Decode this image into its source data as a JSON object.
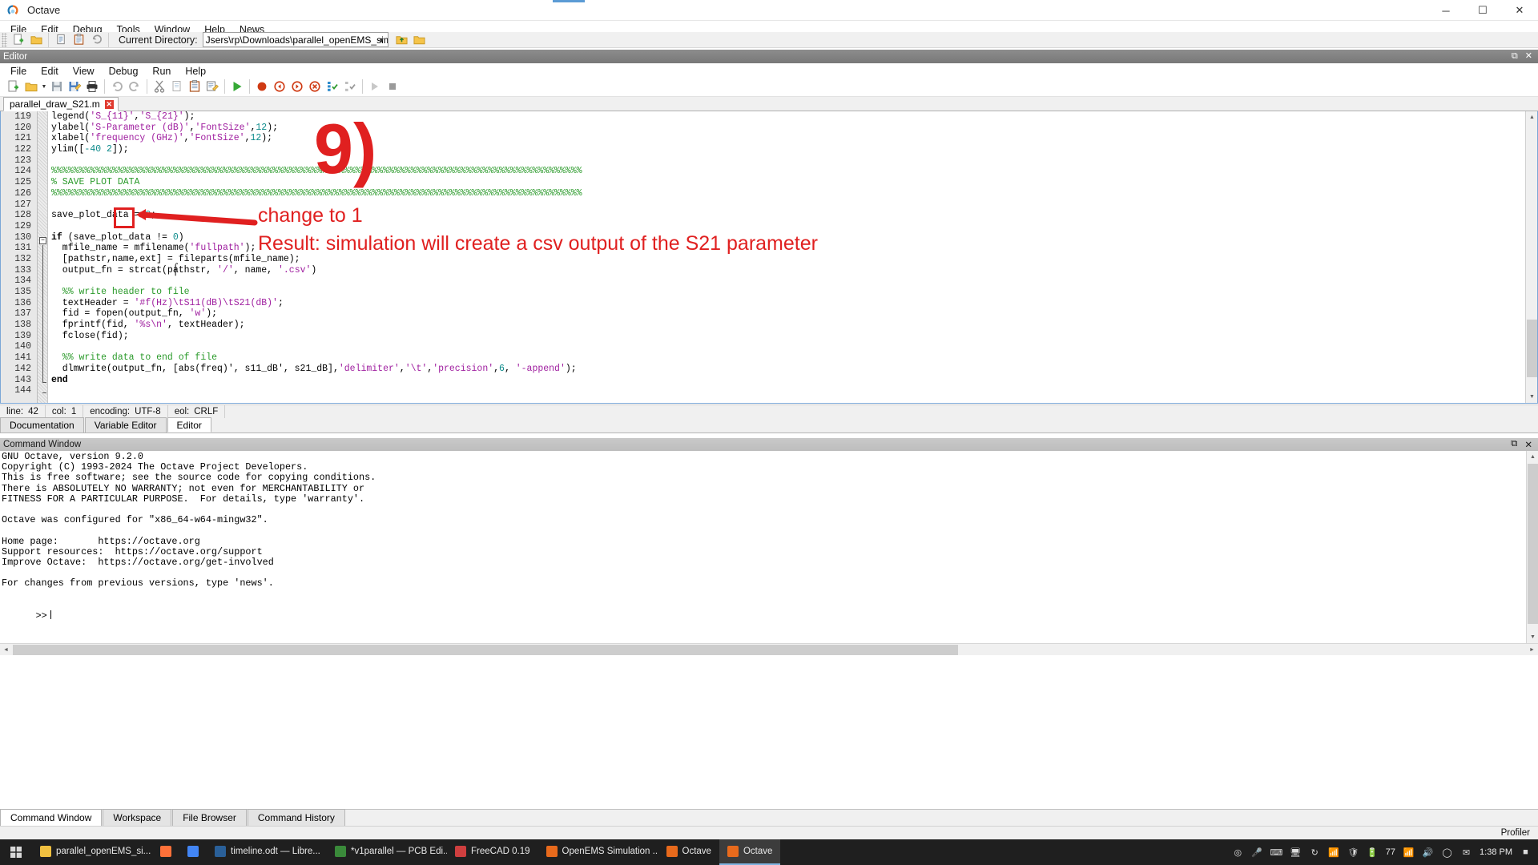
{
  "window": {
    "title": "Octave",
    "app_icon": "octave-logo-icon",
    "controls": {
      "minimize": "─",
      "maximize": "☐",
      "close": "✕"
    }
  },
  "main_menu": {
    "items": [
      "File",
      "Edit",
      "Debug",
      "Tools",
      "Window",
      "Help",
      "News"
    ]
  },
  "main_toolbar": {
    "buttons": [
      {
        "name": "new-script-button",
        "glyph": "new-file-icon"
      },
      {
        "name": "open-file-button",
        "glyph": "folder-open-icon"
      },
      {
        "name": "copy-button",
        "glyph": "copy-icon"
      },
      {
        "name": "paste-button",
        "glyph": "paste-icon"
      },
      {
        "name": "undo-button",
        "glyph": "undo-icon"
      }
    ],
    "current_directory_label": "Current Directory:",
    "current_directory_value": "Jsers\\rp\\Downloads\\parallel_openEMS_simulation",
    "one_dir_up_button": "one-directory-up-icon",
    "browse_dir_button": "browse-directories-icon"
  },
  "editor": {
    "dock_title": "Editor",
    "dock_controls": {
      "undock": "⧉",
      "close": "✕"
    },
    "menu": {
      "items": [
        "File",
        "Edit",
        "View",
        "Debug",
        "Run",
        "Help"
      ]
    },
    "toolbar_buttons": [
      "new-script-icon",
      "open-file-icon",
      "dropdown-arrow-icon",
      "save-file-icon",
      "save-file-as-icon",
      "print-icon",
      "undo-icon",
      "redo-icon",
      "cut-icon",
      "copy-icon",
      "paste-icon",
      "find-replace-icon",
      "run-script-icon",
      "toggle-breakpoint-icon",
      "previous-breakpoint-icon",
      "next-breakpoint-icon",
      "remove-all-breakpoints-icon",
      "step-in-icon",
      "step-out-icon",
      "continue-icon",
      "stop-icon"
    ],
    "tab": {
      "filename": "parallel_draw_S21.m",
      "close_glyph": "✕"
    },
    "status": {
      "line_label": "line:",
      "line_value": "42",
      "col_label": "col:",
      "col_value": "1",
      "encoding_label": "encoding:",
      "encoding_value": "UTF-8",
      "eol_label": "eol:",
      "eol_value": "CRLF"
    },
    "code": [
      {
        "no": "119",
        "segs": [
          {
            "t": "legend(",
            "c": "p"
          },
          {
            "t": "'S_{11}'",
            "c": "s"
          },
          {
            "t": ",",
            "c": "p"
          },
          {
            "t": "'S_{21}'",
            "c": "s"
          },
          {
            "t": ");",
            "c": "p"
          }
        ]
      },
      {
        "no": "120",
        "segs": [
          {
            "t": "ylabel(",
            "c": "p"
          },
          {
            "t": "'S-Parameter (dB)'",
            "c": "s"
          },
          {
            "t": ",",
            "c": "p"
          },
          {
            "t": "'FontSize'",
            "c": "s"
          },
          {
            "t": ",",
            "c": "p"
          },
          {
            "t": "12",
            "c": "n"
          },
          {
            "t": ");",
            "c": "p"
          }
        ]
      },
      {
        "no": "121",
        "segs": [
          {
            "t": "xlabel(",
            "c": "p"
          },
          {
            "t": "'frequency (GHz)'",
            "c": "s"
          },
          {
            "t": ",",
            "c": "p"
          },
          {
            "t": "'FontSize'",
            "c": "s"
          },
          {
            "t": ",",
            "c": "p"
          },
          {
            "t": "12",
            "c": "n"
          },
          {
            "t": ");",
            "c": "p"
          }
        ]
      },
      {
        "no": "122",
        "segs": [
          {
            "t": "ylim([",
            "c": "p"
          },
          {
            "t": "-40",
            "c": "n"
          },
          {
            "t": " ",
            "c": "p"
          },
          {
            "t": "2",
            "c": "n"
          },
          {
            "t": "]);",
            "c": "p"
          }
        ]
      },
      {
        "no": "123",
        "segs": []
      },
      {
        "no": "124",
        "segs": [
          {
            "t": "%%%%%%%%%%%%%%%%%%%%%%%%%%%%%%%%%%%%%%%%%%%%%%%%%%%%%%%%%%%%%%%%%%%%%%%%%%%%%%%%%%%%%%%%%%%%%%%%",
            "c": "c"
          }
        ]
      },
      {
        "no": "125",
        "segs": [
          {
            "t": "% SAVE PLOT DATA",
            "c": "c"
          }
        ]
      },
      {
        "no": "126",
        "segs": [
          {
            "t": "%%%%%%%%%%%%%%%%%%%%%%%%%%%%%%%%%%%%%%%%%%%%%%%%%%%%%%%%%%%%%%%%%%%%%%%%%%%%%%%%%%%%%%%%%%%%%%%%",
            "c": "c"
          }
        ]
      },
      {
        "no": "127",
        "segs": []
      },
      {
        "no": "128",
        "segs": [
          {
            "t": "save_plot_data = ",
            "c": "p"
          },
          {
            "t": "0",
            "c": "n"
          },
          {
            "t": ";",
            "c": "p"
          }
        ]
      },
      {
        "no": "129",
        "segs": []
      },
      {
        "no": "130",
        "segs": [
          {
            "t": "if",
            "c": "k"
          },
          {
            "t": " (save_plot_data != ",
            "c": "p"
          },
          {
            "t": "0",
            "c": "n"
          },
          {
            "t": ")",
            "c": "p"
          }
        ]
      },
      {
        "no": "131",
        "segs": [
          {
            "t": "  mfile_name = mfilename(",
            "c": "p"
          },
          {
            "t": "'fullpath'",
            "c": "s"
          },
          {
            "t": ");",
            "c": "p"
          }
        ]
      },
      {
        "no": "132",
        "segs": [
          {
            "t": "  [pathstr,name,ext] = fileparts(mfile_name);",
            "c": "p"
          }
        ]
      },
      {
        "no": "133",
        "segs": [
          {
            "t": "  output_fn = strcat(pathstr, ",
            "c": "p"
          },
          {
            "t": "'/'",
            "c": "s"
          },
          {
            "t": ", name, ",
            "c": "p"
          },
          {
            "t": "'.csv'",
            "c": "s"
          },
          {
            "t": ")",
            "c": "p"
          }
        ]
      },
      {
        "no": "134",
        "segs": []
      },
      {
        "no": "135",
        "segs": [
          {
            "t": "  %% write header to file",
            "c": "c"
          }
        ]
      },
      {
        "no": "136",
        "segs": [
          {
            "t": "  textHeader = ",
            "c": "p"
          },
          {
            "t": "'#f(Hz)\\tS11(dB)\\tS21(dB)'",
            "c": "s"
          },
          {
            "t": ";",
            "c": "p"
          }
        ]
      },
      {
        "no": "137",
        "segs": [
          {
            "t": "  fid = fopen(output_fn, ",
            "c": "p"
          },
          {
            "t": "'w'",
            "c": "s"
          },
          {
            "t": ");",
            "c": "p"
          }
        ]
      },
      {
        "no": "138",
        "segs": [
          {
            "t": "  fprintf(fid, ",
            "c": "p"
          },
          {
            "t": "'%s\\n'",
            "c": "s"
          },
          {
            "t": ", textHeader);",
            "c": "p"
          }
        ]
      },
      {
        "no": "139",
        "segs": [
          {
            "t": "  fclose(fid);",
            "c": "p"
          }
        ]
      },
      {
        "no": "140",
        "segs": []
      },
      {
        "no": "141",
        "segs": [
          {
            "t": "  %% write data to end of file",
            "c": "c"
          }
        ]
      },
      {
        "no": "142",
        "segs": [
          {
            "t": "  dlmwrite(output_fn, [abs(freq)', s11_dB', s21_dB],",
            "c": "p"
          },
          {
            "t": "'delimiter'",
            "c": "s"
          },
          {
            "t": ",",
            "c": "p"
          },
          {
            "t": "'\\t'",
            "c": "s"
          },
          {
            "t": ",",
            "c": "p"
          },
          {
            "t": "'precision'",
            "c": "s"
          },
          {
            "t": ",",
            "c": "p"
          },
          {
            "t": "6",
            "c": "n"
          },
          {
            "t": ", ",
            "c": "p"
          },
          {
            "t": "'-append'",
            "c": "s"
          },
          {
            "t": ");",
            "c": "p"
          }
        ]
      },
      {
        "no": "143",
        "segs": [
          {
            "t": "end",
            "c": "k"
          }
        ]
      },
      {
        "no": "144",
        "segs": []
      }
    ]
  },
  "annotations": {
    "step_number": "9)",
    "callout_1": "change to 1",
    "callout_2": "Result: simulation will create a csv output of the S21 parameter",
    "color": "#e02020",
    "highlight_box_target": "save_plot_data value 0"
  },
  "editor_dock_tabs": {
    "tabs": [
      "Documentation",
      "Variable Editor",
      "Editor"
    ],
    "active": "Editor"
  },
  "command_window": {
    "dock_title": "Command Window",
    "dock_controls": {
      "undock": "⧉",
      "close": "✕"
    },
    "lines": [
      "GNU Octave, version 9.2.0",
      "Copyright (C) 1993-2024 The Octave Project Developers.",
      "This is free software; see the source code for copying conditions.",
      "There is ABSOLUTELY NO WARRANTY; not even for MERCHANTABILITY or",
      "FITNESS FOR A PARTICULAR PURPOSE.  For details, type 'warranty'.",
      "",
      "Octave was configured for \"x86_64-w64-mingw32\".",
      "",
      "Home page:       https://octave.org",
      "Support resources:  https://octave.org/support",
      "Improve Octave:  https://octave.org/get-involved",
      "",
      "For changes from previous versions, type 'news'.",
      ""
    ],
    "prompt": ">>"
  },
  "bottom_tabs": {
    "tabs": [
      "Command Window",
      "Workspace",
      "File Browser",
      "Command History"
    ],
    "active": "Command Window"
  },
  "app_status": {
    "right_label": "Profiler"
  },
  "taskbar": {
    "start_button": "windows-start-icon",
    "items": [
      {
        "label": "parallel_openEMS_si...",
        "icon": "folder-icon",
        "color": "#f0c040",
        "active": false
      },
      {
        "label": "",
        "icon": "firefox-icon",
        "color": "#ff7139",
        "active": false
      },
      {
        "label": "",
        "icon": "chrome-icon",
        "color": "#4285f4",
        "active": false
      },
      {
        "label": "timeline.odt — Libre...",
        "icon": "libreoffice-writer-icon",
        "color": "#2a6099",
        "active": false
      },
      {
        "label": "*v1parallel — PCB Edi...",
        "icon": "kicad-pcb-icon",
        "color": "#3a8a3a",
        "active": false
      },
      {
        "label": "FreeCAD 0.19",
        "icon": "freecad-icon",
        "color": "#cf3f3f",
        "active": false
      },
      {
        "label": "OpenEMS Simulation ...",
        "icon": "octave-logo-icon",
        "color": "#e86a1c",
        "active": false
      },
      {
        "label": "Octave",
        "icon": "octave-logo-icon",
        "color": "#e86a1c",
        "active": false
      },
      {
        "label": "Octave",
        "icon": "octave-logo-icon",
        "color": "#e86a1c",
        "active": true
      }
    ],
    "tray_icons": [
      "teamviewer-icon",
      "microphone-icon",
      "keyboard-icon",
      "monitor-icon",
      "update-icon",
      "bluetooth-icon",
      "shield-icon",
      "battery-icon"
    ],
    "tray_count": "77",
    "network_icon": "wifi-icon",
    "volume_icon": "speaker-icon",
    "extra_icons": [
      "language-icon",
      "notification-icon"
    ],
    "clock_time": "1:38 PM",
    "clock_date": ""
  }
}
